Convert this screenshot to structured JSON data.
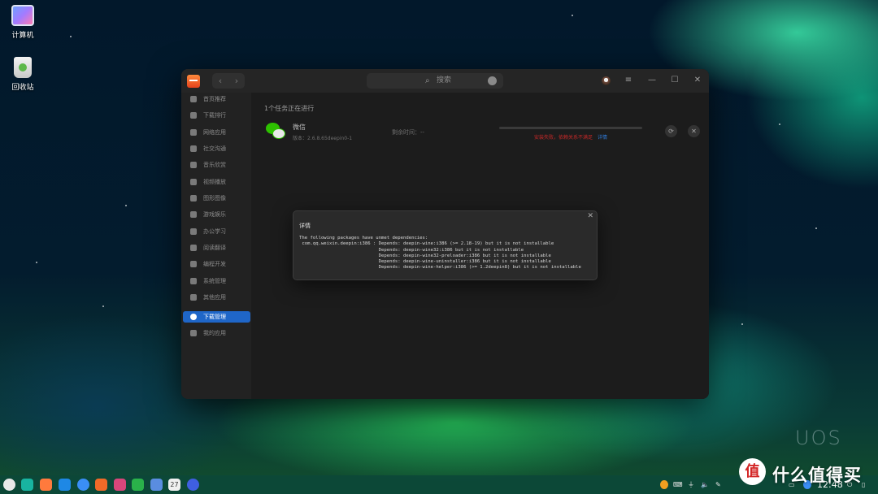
{
  "desktop": {
    "icons": [
      {
        "label": "计算机"
      },
      {
        "label": "回收站"
      }
    ]
  },
  "window": {
    "nav": {
      "back": "‹",
      "forward": "›"
    },
    "search": {
      "placeholder": "搜索",
      "icon": "search-icon"
    },
    "controls": {
      "menu": "≡",
      "minimize": "—",
      "maximize": "☐",
      "close": "✕"
    },
    "sidebar": {
      "items": [
        {
          "label": "首页推荐",
          "icon": "star-icon"
        },
        {
          "label": "下载排行",
          "icon": "crown-icon"
        },
        {
          "label": "网络应用",
          "icon": "globe-icon"
        },
        {
          "label": "社交沟通",
          "icon": "chat-icon"
        },
        {
          "label": "音乐欣赏",
          "icon": "music-icon"
        },
        {
          "label": "视频播放",
          "icon": "video-icon"
        },
        {
          "label": "图形图像",
          "icon": "image-icon"
        },
        {
          "label": "游戏娱乐",
          "icon": "gamepad-icon"
        },
        {
          "label": "办公学习",
          "icon": "office-icon"
        },
        {
          "label": "阅读翻译",
          "icon": "book-icon"
        },
        {
          "label": "编程开发",
          "icon": "code-icon"
        },
        {
          "label": "系统管理",
          "icon": "system-icon"
        },
        {
          "label": "其他应用",
          "icon": "more-icon"
        }
      ],
      "bottom_items": [
        {
          "label": "下载管理",
          "icon": "download-icon",
          "active": true
        },
        {
          "label": "我的应用",
          "icon": "apps-icon",
          "active": false
        }
      ]
    },
    "main": {
      "task_count": "1个任务正在进行",
      "download": {
        "name": "微信",
        "version": "版本：2.6.8.65deepin0-1",
        "remaining": "剩余时间：--",
        "progress": 0,
        "error": "安装失败，依赖关系不满足",
        "error_link": "详情",
        "retry_icon": "⟳",
        "cancel_icon": "✕"
      }
    }
  },
  "dialog": {
    "title": "详情",
    "close": "✕",
    "lines": [
      "The following packages have unmet dependencies:",
      " com.qq.weixin.deepin:i386 : Depends: deepin-wine:i386 (>= 2.18-19) but it is not installable",
      "                             Depends: deepin-wine32:i386 but it is not installable",
      "                             Depends: deepin-wine32-preloader:i386 but it is not installable",
      "                             Depends: deepin-wine-uninstaller:i386 but it is not installable",
      "                             Depends: deepin-wine-helper:i386 (>= 1.2deepin8) but it is not installable"
    ]
  },
  "branding": {
    "uos": "UOS"
  },
  "taskbar": {
    "apps": [
      {
        "name": "launcher",
        "color": "#e9e9e9"
      },
      {
        "name": "file-manager",
        "color": "#18b4a0"
      },
      {
        "name": "multitask-view",
        "color": "#ff7a3d"
      },
      {
        "name": "app-store-blue",
        "color": "#1e88e5"
      },
      {
        "name": "browser",
        "color": "#3a8ef5"
      },
      {
        "name": "app-store",
        "color": "#f06a28"
      },
      {
        "name": "photos",
        "color": "#d9467b"
      },
      {
        "name": "music",
        "color": "#2ab24a"
      },
      {
        "name": "document-viewer",
        "color": "#5a8de0"
      },
      {
        "name": "calendar",
        "color": "#f0f0f0"
      },
      {
        "name": "settings",
        "color": "#3f5fe0"
      }
    ],
    "calendar_day": "27",
    "clock": "12:48"
  },
  "watermark": {
    "badge": "值",
    "text": "什么值得买"
  }
}
